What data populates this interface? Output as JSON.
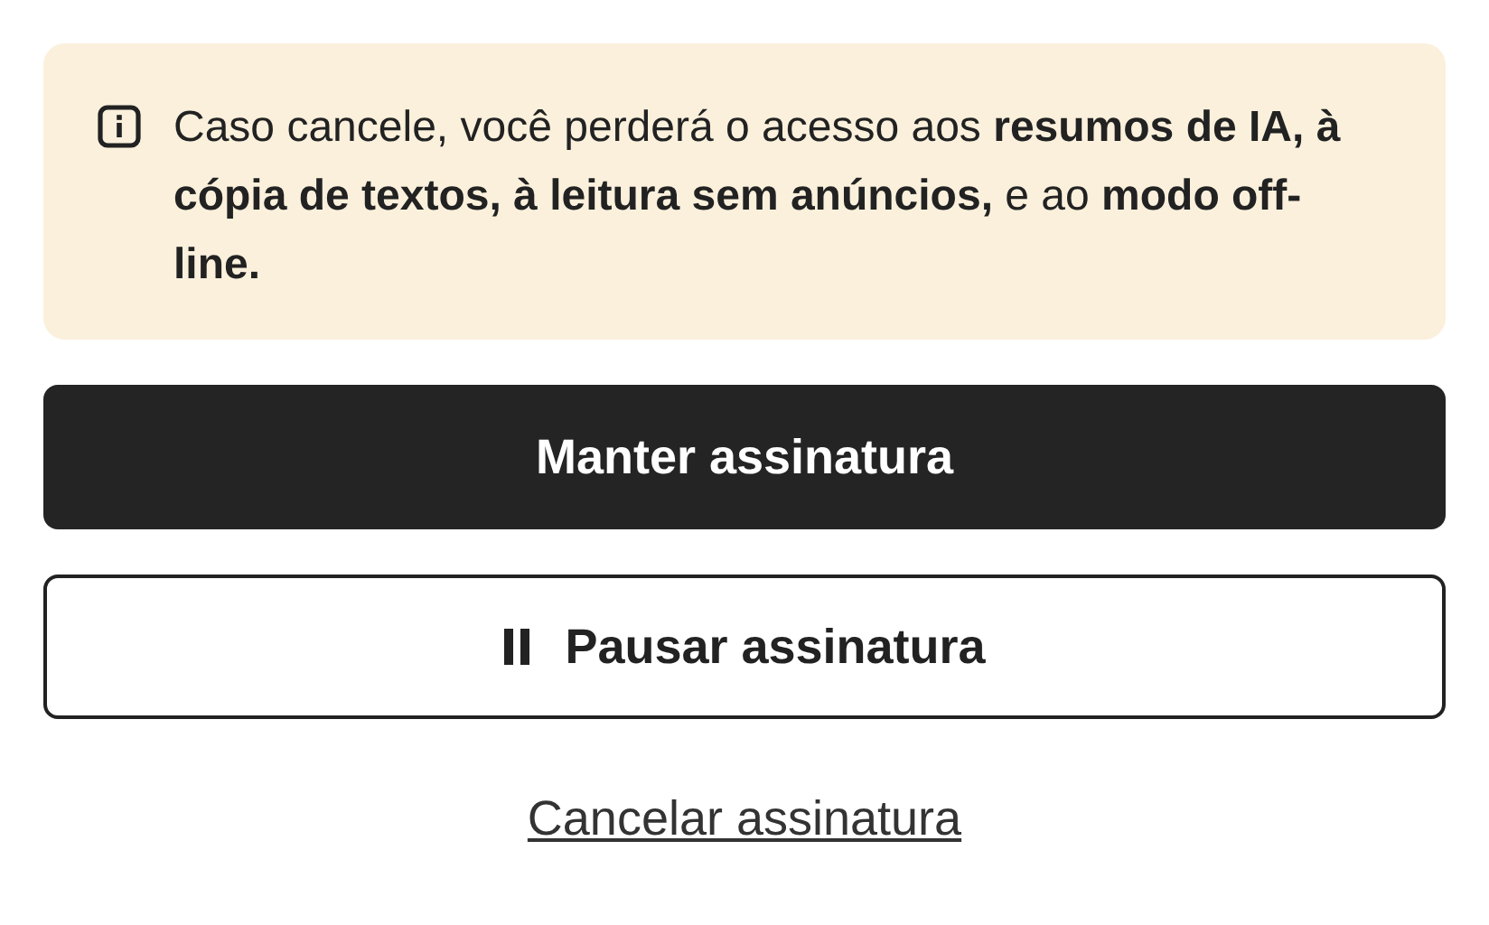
{
  "notice": {
    "text": "Caso cancele, você perderá o acesso aos **resumos de IA, à cópia de textos, à leitura sem anúncios,** e ao **modo off-line.**"
  },
  "actions": [
    {
      "kind": "primary",
      "label": "Manter assinatura"
    },
    {
      "kind": "outline",
      "label": "Pausar assinatura"
    },
    {
      "kind": "link",
      "label": "Cancelar assinatura"
    }
  ]
}
